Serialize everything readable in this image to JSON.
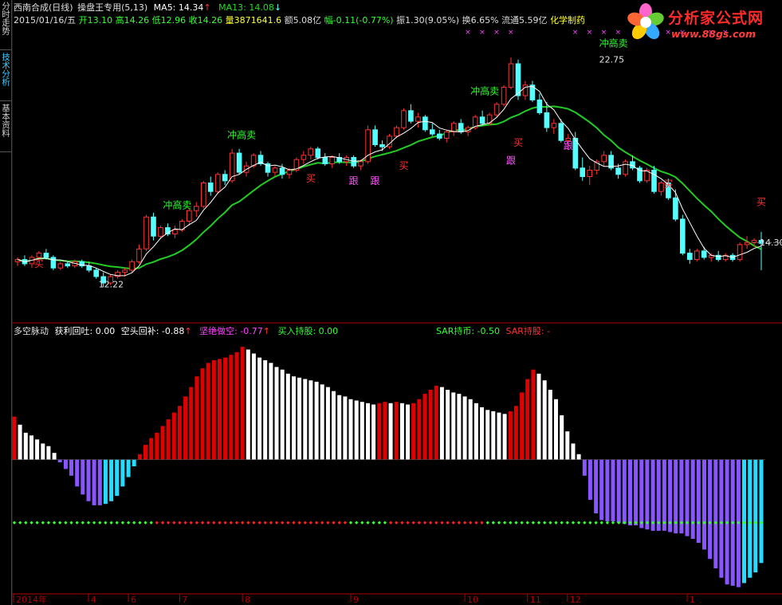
{
  "sidebar": {
    "tabs": [
      {
        "label": "分时走势",
        "active": false
      },
      {
        "label": "技术分析",
        "active": true
      },
      {
        "label": "基本资料",
        "active": false
      }
    ]
  },
  "header": {
    "stock": "西南合成(日线)",
    "indicator": "操盘王专用(5,13)",
    "ma5": "MA5: 14.34",
    "ma13": "MA13: 14.08",
    "date": "2015/01/16/五",
    "open": "开13.10",
    "high": "高14.26",
    "low": "低12.96",
    "close": "收14.26",
    "volume": "量3871641.6",
    "amount": "额5.08亿",
    "change": "幅-0.11(-0.77%)",
    "amplitude": "振1.30(9.05%)",
    "turnover": "换6.65%",
    "float": "流通5.59亿",
    "sector": "化学制药"
  },
  "lower_header": {
    "name": "多空脉动",
    "profit": "获利回吐: 0.00",
    "short_cover": "空头回补: -0.88",
    "short": "坚绝做空: -0.77",
    "buy_hold": "买入持股: 0.00",
    "sar_coin": "SAR持币: -0.50",
    "sar_hold": "SAR持股: -"
  },
  "logo": {
    "title": "分析家公式网",
    "url": "www.88gs.com"
  },
  "colors": {
    "up": "#ff3232",
    "down": "#54ffff",
    "ma5": "#ffffff",
    "ma13": "#22cc22",
    "signal_sell": "#33ff33",
    "signal_buy": "#ff3232",
    "signal_follow": "#ff55ff",
    "bar_red": "#e00000",
    "bar_white": "#ffffff",
    "bar_purple": "#8855ff",
    "bar_cyan": "#22ddff",
    "axis": "#b00000",
    "cross": "#ff44ff"
  },
  "chart_data": {
    "type": "candlestick",
    "price_range": [
      10.9,
      24.2
    ],
    "last_price_label": "14.30",
    "high_label": "22.75",
    "low_label": "12.22",
    "candles": [
      [
        13.4,
        13.6,
        13.2,
        13.5
      ],
      [
        13.5,
        13.7,
        13.2,
        13.3
      ],
      [
        13.3,
        13.7,
        13.1,
        13.6
      ],
      [
        13.6,
        13.9,
        13.4,
        13.8
      ],
      [
        13.8,
        14.0,
        13.5,
        13.6
      ],
      [
        13.6,
        13.7,
        13.0,
        13.1
      ],
      [
        13.1,
        13.4,
        13.0,
        13.3
      ],
      [
        13.3,
        13.4,
        13.1,
        13.2
      ],
      [
        13.2,
        13.5,
        13.1,
        13.4
      ],
      [
        13.4,
        13.5,
        13.1,
        13.2
      ],
      [
        13.2,
        13.4,
        12.9,
        13.0
      ],
      [
        13.0,
        13.1,
        12.6,
        12.7
      ],
      [
        12.7,
        12.9,
        12.2,
        12.4
      ],
      [
        12.4,
        12.8,
        12.3,
        12.7
      ],
      [
        12.7,
        13.0,
        12.6,
        12.9
      ],
      [
        12.9,
        13.1,
        12.7,
        13.0
      ],
      [
        13.0,
        13.5,
        12.9,
        13.4
      ],
      [
        13.4,
        14.2,
        13.3,
        14.0
      ],
      [
        14.0,
        15.6,
        13.9,
        15.5
      ],
      [
        15.5,
        15.7,
        14.4,
        14.6
      ],
      [
        14.6,
        15.1,
        14.5,
        15.0
      ],
      [
        15.0,
        15.2,
        14.6,
        14.7
      ],
      [
        14.7,
        15.1,
        14.5,
        14.9
      ],
      [
        14.9,
        15.4,
        14.8,
        15.3
      ],
      [
        15.3,
        15.9,
        15.1,
        15.8
      ],
      [
        15.8,
        16.2,
        15.5,
        16.0
      ],
      [
        16.0,
        17.2,
        15.9,
        17.1
      ],
      [
        17.1,
        17.4,
        16.5,
        16.7
      ],
      [
        16.7,
        17.6,
        16.6,
        17.5
      ],
      [
        17.5,
        17.7,
        17.0,
        17.2
      ],
      [
        17.2,
        18.7,
        17.1,
        18.5
      ],
      [
        18.5,
        18.7,
        17.5,
        17.6
      ],
      [
        17.6,
        18.1,
        17.4,
        17.9
      ],
      [
        17.9,
        18.5,
        17.8,
        18.4
      ],
      [
        18.4,
        18.6,
        17.9,
        18.0
      ],
      [
        18.0,
        18.1,
        17.4,
        17.6
      ],
      [
        17.6,
        17.9,
        17.4,
        17.8
      ],
      [
        17.8,
        18.0,
        17.3,
        17.5
      ],
      [
        17.5,
        17.8,
        17.3,
        17.7
      ],
      [
        17.7,
        18.3,
        17.6,
        18.2
      ],
      [
        18.2,
        18.6,
        18.0,
        18.4
      ],
      [
        18.4,
        18.8,
        18.2,
        18.7
      ],
      [
        18.7,
        18.8,
        18.2,
        18.3
      ],
      [
        18.3,
        18.5,
        17.9,
        18.0
      ],
      [
        18.0,
        18.4,
        17.8,
        18.3
      ],
      [
        18.3,
        18.5,
        18.0,
        18.1
      ],
      [
        18.1,
        18.4,
        17.9,
        18.3
      ],
      [
        18.3,
        18.4,
        17.8,
        17.9
      ],
      [
        17.9,
        18.2,
        17.7,
        18.1
      ],
      [
        18.1,
        19.8,
        18.0,
        19.6
      ],
      [
        19.6,
        19.8,
        18.8,
        18.9
      ],
      [
        18.9,
        19.1,
        18.6,
        18.8
      ],
      [
        18.8,
        19.4,
        18.7,
        19.3
      ],
      [
        19.3,
        19.8,
        19.2,
        19.7
      ],
      [
        19.7,
        20.6,
        19.6,
        20.5
      ],
      [
        20.5,
        20.8,
        19.9,
        20.0
      ],
      [
        20.0,
        20.4,
        19.7,
        20.2
      ],
      [
        20.2,
        20.3,
        19.5,
        19.6
      ],
      [
        19.6,
        19.9,
        19.3,
        19.4
      ],
      [
        19.4,
        19.6,
        19.1,
        19.2
      ],
      [
        19.2,
        19.6,
        19.0,
        19.5
      ],
      [
        19.5,
        20.0,
        19.3,
        19.9
      ],
      [
        19.9,
        20.1,
        19.4,
        19.5
      ],
      [
        19.5,
        19.8,
        19.3,
        19.7
      ],
      [
        19.7,
        20.3,
        19.6,
        20.2
      ],
      [
        20.2,
        20.5,
        19.8,
        19.9
      ],
      [
        19.9,
        20.4,
        19.8,
        20.3
      ],
      [
        20.3,
        20.9,
        20.2,
        20.8
      ],
      [
        20.8,
        21.7,
        20.7,
        21.6
      ],
      [
        21.6,
        23.0,
        21.5,
        22.7
      ],
      [
        22.7,
        22.9,
        21.0,
        21.2
      ],
      [
        21.2,
        21.9,
        21.0,
        21.7
      ],
      [
        21.7,
        21.9,
        20.9,
        21.0
      ],
      [
        21.0,
        21.3,
        20.3,
        20.4
      ],
      [
        20.4,
        20.9,
        19.5,
        19.7
      ],
      [
        19.7,
        20.1,
        19.4,
        19.9
      ],
      [
        19.9,
        20.1,
        19.0,
        19.1
      ],
      [
        19.1,
        19.4,
        18.7,
        19.2
      ],
      [
        19.2,
        19.5,
        17.7,
        17.8
      ],
      [
        17.8,
        18.3,
        17.2,
        17.4
      ],
      [
        17.4,
        17.9,
        17.0,
        17.7
      ],
      [
        17.7,
        18.2,
        17.5,
        18.1
      ],
      [
        18.1,
        18.6,
        17.9,
        18.4
      ],
      [
        18.4,
        18.6,
        17.7,
        17.8
      ],
      [
        17.8,
        18.0,
        17.3,
        17.5
      ],
      [
        17.5,
        18.2,
        17.4,
        18.1
      ],
      [
        18.1,
        18.4,
        17.7,
        17.8
      ],
      [
        17.8,
        17.9,
        17.1,
        17.2
      ],
      [
        17.2,
        17.8,
        17.1,
        17.7
      ],
      [
        17.7,
        17.9,
        16.6,
        16.7
      ],
      [
        16.7,
        17.2,
        16.5,
        17.1
      ],
      [
        17.1,
        17.3,
        16.3,
        16.4
      ],
      [
        16.4,
        16.8,
        15.3,
        15.4
      ],
      [
        15.4,
        15.6,
        13.7,
        13.8
      ],
      [
        13.8,
        14.0,
        13.3,
        13.5
      ],
      [
        13.5,
        14.0,
        13.4,
        13.9
      ],
      [
        13.9,
        14.1,
        13.5,
        13.6
      ],
      [
        13.6,
        13.8,
        13.4,
        13.7
      ],
      [
        13.7,
        13.9,
        13.4,
        13.5
      ],
      [
        13.5,
        13.8,
        13.4,
        13.7
      ],
      [
        13.7,
        13.8,
        13.4,
        13.5
      ],
      [
        13.5,
        14.3,
        13.4,
        14.2
      ],
      [
        14.2,
        14.6,
        14.0,
        14.3
      ],
      [
        14.3,
        14.5,
        14.1,
        14.4
      ],
      [
        14.4,
        14.8,
        13.0,
        14.26
      ]
    ],
    "signals": [
      {
        "text": "买",
        "i": 3,
        "price": 13.15,
        "kind": "buy"
      },
      {
        "text": "冲高卖",
        "i": 21,
        "price": 15.9,
        "kind": "sell"
      },
      {
        "text": "12.22",
        "i": 12,
        "price": 12.2,
        "kind": "low"
      },
      {
        "text": "冲高卖",
        "i": 30,
        "price": 19.2,
        "kind": "sell"
      },
      {
        "text": "买",
        "i": 41,
        "price": 17.15,
        "kind": "buy"
      },
      {
        "text": "跟",
        "i": 47,
        "price": 17.05,
        "kind": "follow"
      },
      {
        "text": "跟",
        "i": 50,
        "price": 17.05,
        "kind": "follow"
      },
      {
        "text": "买",
        "i": 54,
        "price": 17.75,
        "kind": "buy"
      },
      {
        "text": "冲高卖",
        "i": 64,
        "price": 21.25,
        "kind": "sell"
      },
      {
        "text": "买",
        "i": 70,
        "price": 18.85,
        "kind": "buy"
      },
      {
        "text": "跟",
        "i": 69,
        "price": 18.0,
        "kind": "follow"
      },
      {
        "text": "跟",
        "i": 77,
        "price": 18.7,
        "kind": "follow"
      },
      {
        "text": "冲高卖",
        "i": 82,
        "price": 23.5,
        "kind": "sell"
      },
      {
        "text": "22.75",
        "i": 82,
        "price": 22.75,
        "kind": "high"
      },
      {
        "text": "买",
        "i": 91,
        "price": 16.9,
        "kind": "buy"
      },
      {
        "text": "买",
        "i": 104,
        "price": 16.05,
        "kind": "buy"
      },
      {
        "text": "买",
        "i": 113,
        "price": 13.25,
        "kind": "buy"
      }
    ],
    "cross_marks_i": [
      63,
      65,
      67,
      69,
      78,
      80,
      82,
      84,
      89,
      91,
      93,
      97,
      99
    ],
    "x_axis_labels": [
      {
        "text": "2014年",
        "i": 0
      },
      {
        "text": "4",
        "i": 13
      },
      {
        "text": "6",
        "i": 20
      },
      {
        "text": "7",
        "i": 29
      },
      {
        "text": "8",
        "i": 40
      },
      {
        "text": "9",
        "i": 59
      },
      {
        "text": "10",
        "i": 79
      },
      {
        "text": "11",
        "i": 90
      },
      {
        "text": "12",
        "i": 97
      },
      {
        "text": "1",
        "i": 118
      }
    ],
    "oscillator": {
      "range": [
        -10,
        9
      ],
      "values": [
        3.2,
        2.6,
        2.0,
        1.8,
        1.5,
        1.2,
        1.0,
        0.5,
        -0.2,
        -0.7,
        -1.2,
        -2.0,
        -2.6,
        -3.1,
        -3.4,
        -3.4,
        -3.3,
        -3.1,
        -2.7,
        -2.0,
        -1.3,
        -0.5,
        0.4,
        1.1,
        1.6,
        2.0,
        2.5,
        3.0,
        3.5,
        4.0,
        4.7,
        5.4,
        6.2,
        6.8,
        7.2,
        7.4,
        7.5,
        7.6,
        7.8,
        8.0,
        8.4,
        8.2,
        7.9,
        7.6,
        7.4,
        7.2,
        6.9,
        6.7,
        6.4,
        6.2,
        6.1,
        6.0,
        5.9,
        5.8,
        5.6,
        5.4,
        5.1,
        4.8,
        4.7,
        4.5,
        4.4,
        4.3,
        4.2,
        4.1,
        4.2,
        4.3,
        4.2,
        4.3,
        4.2,
        4.1,
        4.2,
        4.5,
        4.9,
        5.2,
        5.5,
        5.4,
        5.2,
        5.0,
        4.9,
        4.7,
        4.5,
        4.2,
        3.9,
        3.7,
        3.6,
        3.5,
        3.4,
        3.6,
        4.0,
        5.0,
        6.0,
        6.7,
        6.4,
        5.9,
        5.2,
        4.5,
        3.3,
        2.1,
        1.2,
        0.4,
        -1.2,
        -3.0,
        -4.0,
        -4.5,
        -4.6,
        -4.6,
        -4.7,
        -4.8,
        -4.9,
        -4.9,
        -5.1,
        -5.2,
        -5.3,
        -5.3,
        -5.3,
        -5.4,
        -5.5,
        -5.5,
        -5.7,
        -5.9,
        -6.2,
        -6.7,
        -7.4,
        -8.1,
        -8.8,
        -9.3,
        -9.4,
        -9.5,
        -9.2,
        -8.8,
        -8.4,
        -7.7
      ]
    },
    "sar_line_y": -4.7
  }
}
